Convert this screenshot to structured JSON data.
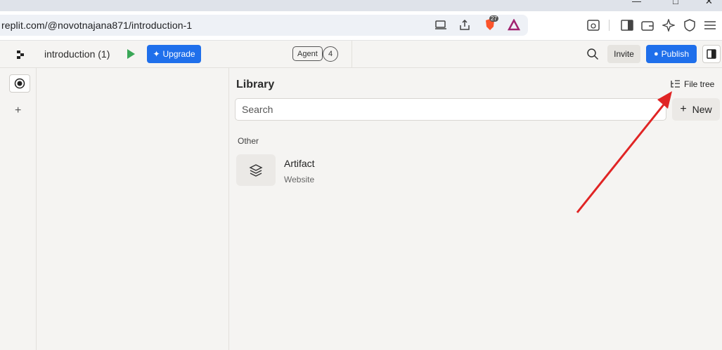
{
  "browser": {
    "url": "replit.com/@novotnajana871/introduction-1",
    "brave_shield_count": "27"
  },
  "header": {
    "project_name": "introduction (1)",
    "upgrade_label": "Upgrade",
    "agent_label": "Agent",
    "agent_count": "4",
    "invite_label": "Invite",
    "publish_label": "Publish"
  },
  "library": {
    "title": "Library",
    "file_tree_label": "File tree",
    "search_placeholder": "Search",
    "new_label": "New",
    "section_label": "Other",
    "items": [
      {
        "name": "Artifact",
        "type": "Website"
      }
    ]
  },
  "colors": {
    "accent": "#1f6feb",
    "play": "#3aa757",
    "arrow": "#e02424"
  }
}
